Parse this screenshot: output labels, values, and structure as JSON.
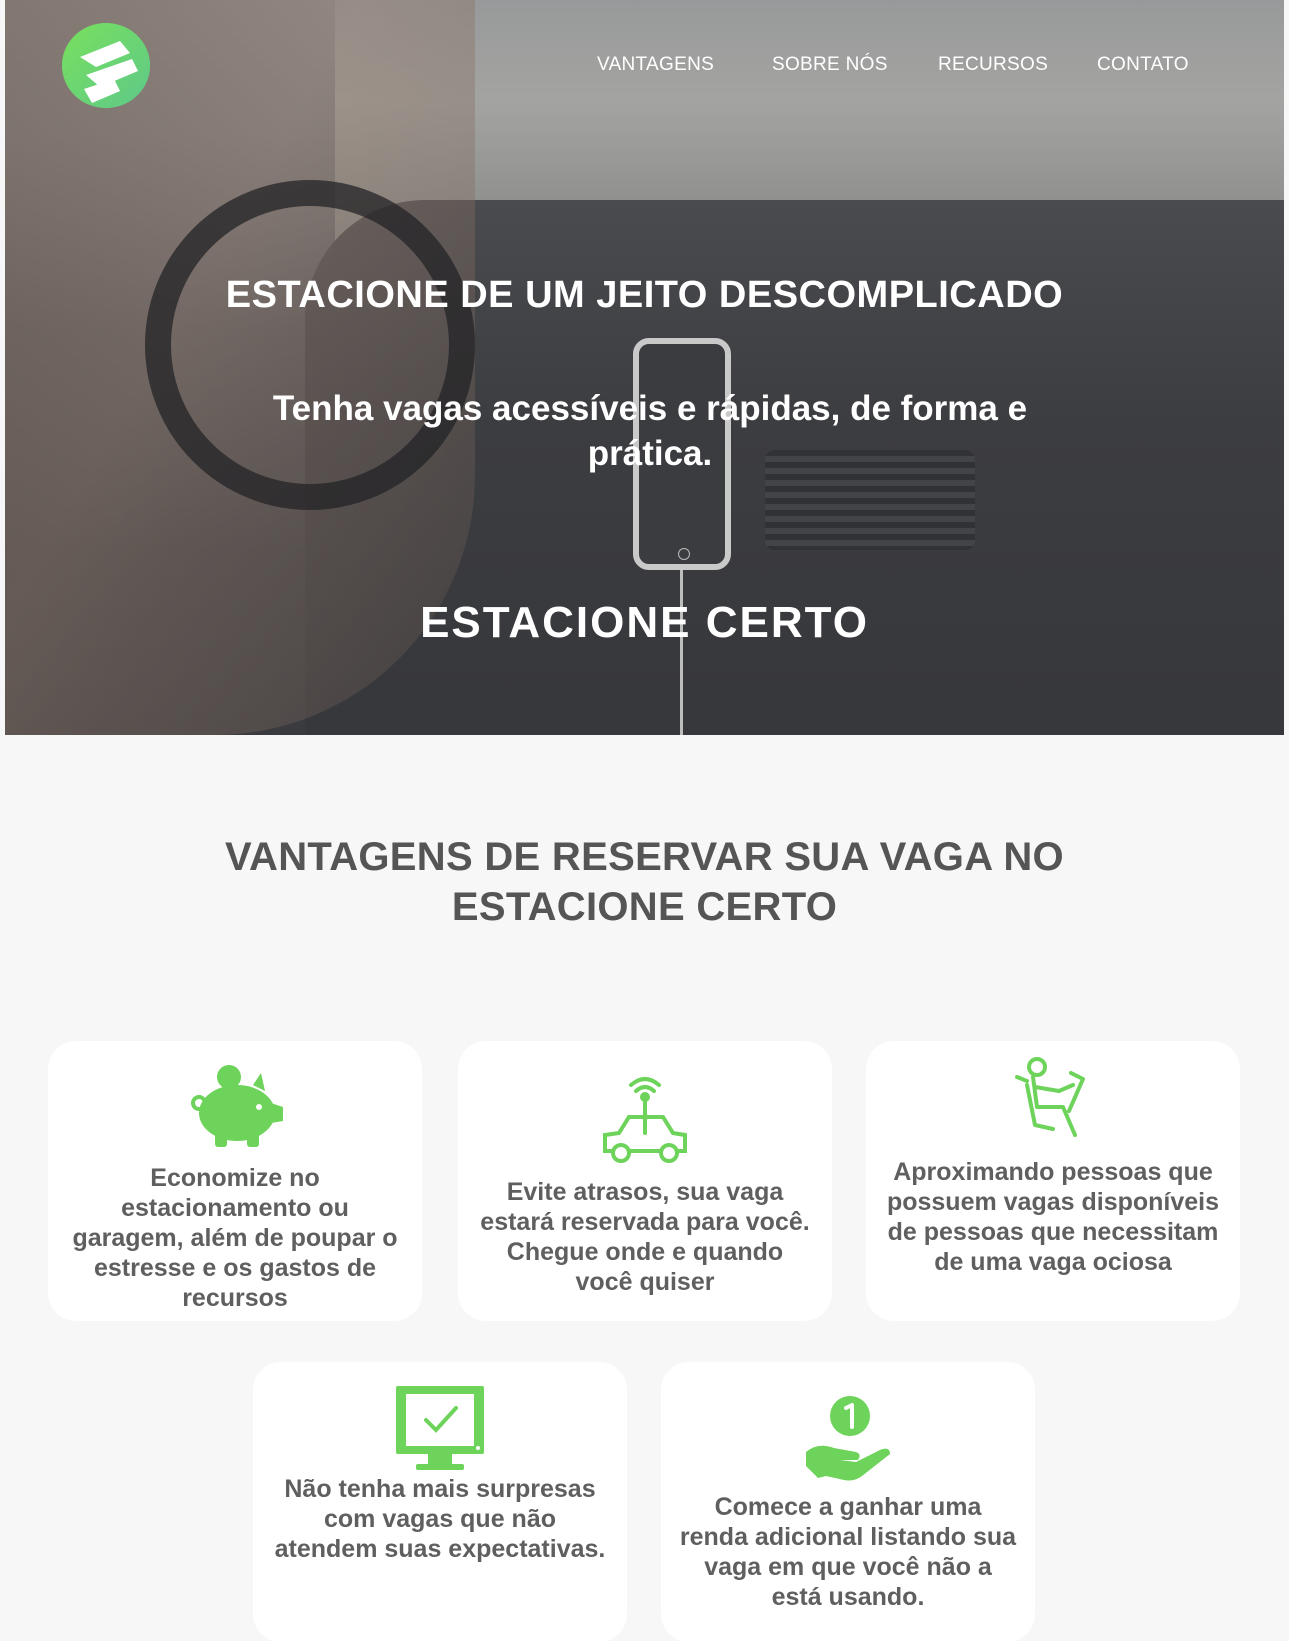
{
  "nav": {
    "items": [
      {
        "label": "VANTAGENS"
      },
      {
        "label": "SOBRE NÓS"
      },
      {
        "label": "RECURSOS"
      },
      {
        "label": "CONTATO"
      }
    ]
  },
  "hero": {
    "title": "ESTACIONE DE UM JEITO DESCOMPLICADO",
    "subtitle": "Tenha vagas acessíveis e rápidas, de forma e prática.",
    "brand": "ESTACIONE CERTO"
  },
  "advantages": {
    "title": "VANTAGENS DE RESERVAR SUA VAGA NO ESTACIONE CERTO",
    "cards": [
      {
        "icon": "piggy-bank-icon",
        "text": "Economize no estacionamento ou garagem, além de poupar o estresse e os gastos de recursos"
      },
      {
        "icon": "connected-car-icon",
        "text": "Evite atrasos, sua vaga estará reservada para você. Chegue onde e quando você quiser"
      },
      {
        "icon": "driver-seat-icon",
        "text": "Aproximando pessoas que possuem vagas disponíveis de pessoas que necessitam de uma vaga ociosa"
      },
      {
        "icon": "monitor-check-icon",
        "text": "Não tenha mais surpresas com vagas que não atendem suas expectativas."
      },
      {
        "icon": "hand-coin-icon",
        "text": "Comece a ganhar uma renda adicional listando sua vaga em que você não a está usando."
      }
    ]
  },
  "colors": {
    "accent": "#6dd35a",
    "text": "#555555",
    "background": "#f7f7f7",
    "card": "#ffffff"
  }
}
